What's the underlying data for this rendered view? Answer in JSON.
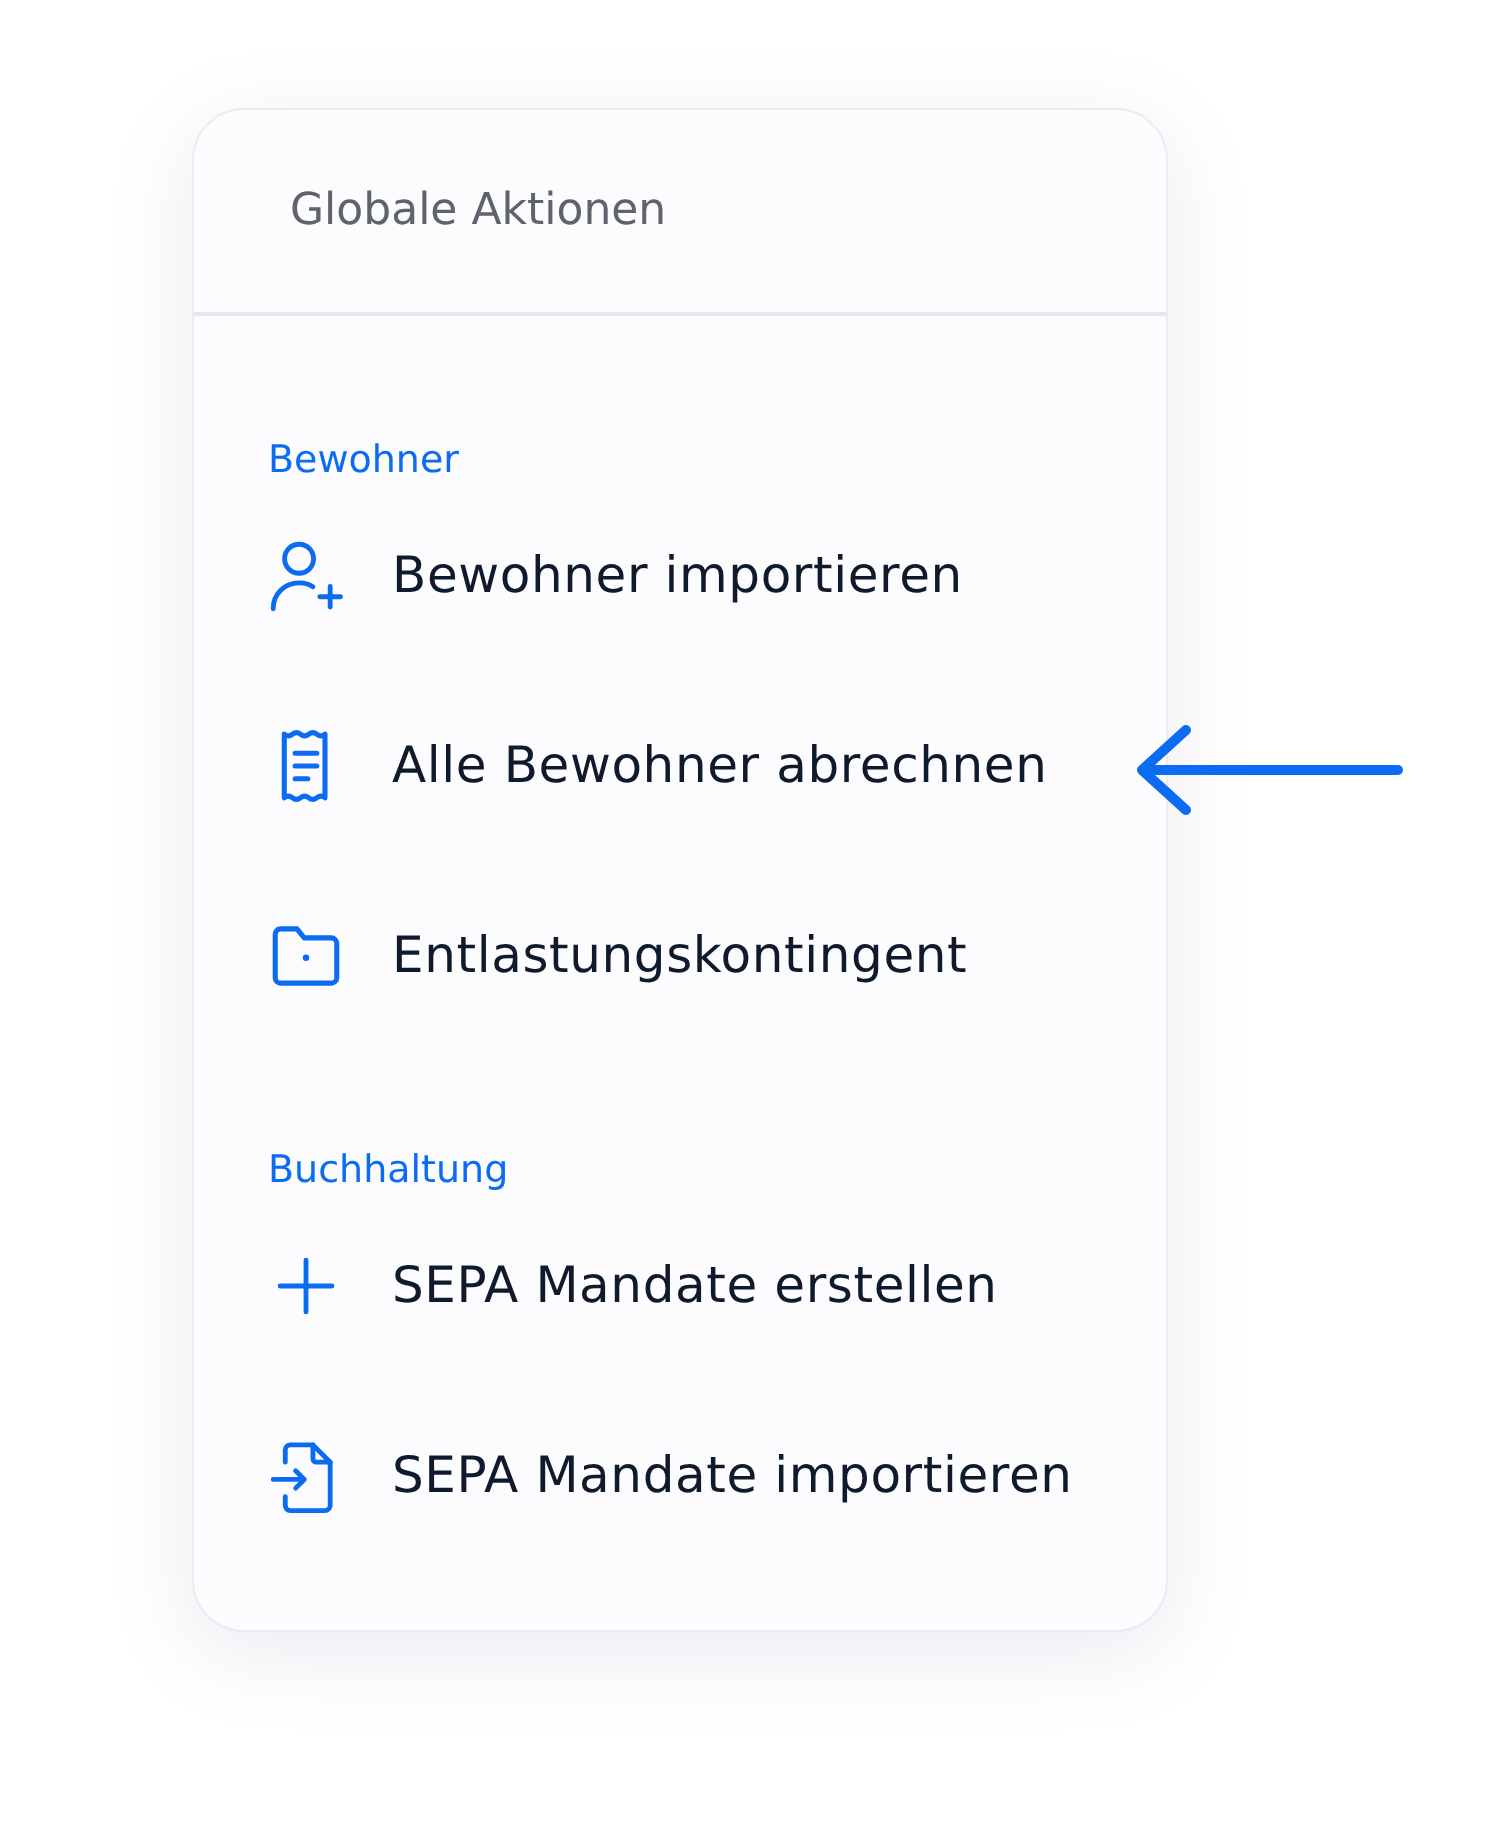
{
  "panel": {
    "title": "Globale Aktionen",
    "sections": [
      {
        "heading": "Bewohner",
        "items": [
          "Bewohner importieren",
          "Alle Bewohner abrechnen",
          "Entlastungskontingent"
        ]
      },
      {
        "heading": "Buchhaltung",
        "items": [
          "SEPA Mandate erstellen",
          "SEPA Mandate importieren"
        ]
      }
    ]
  }
}
